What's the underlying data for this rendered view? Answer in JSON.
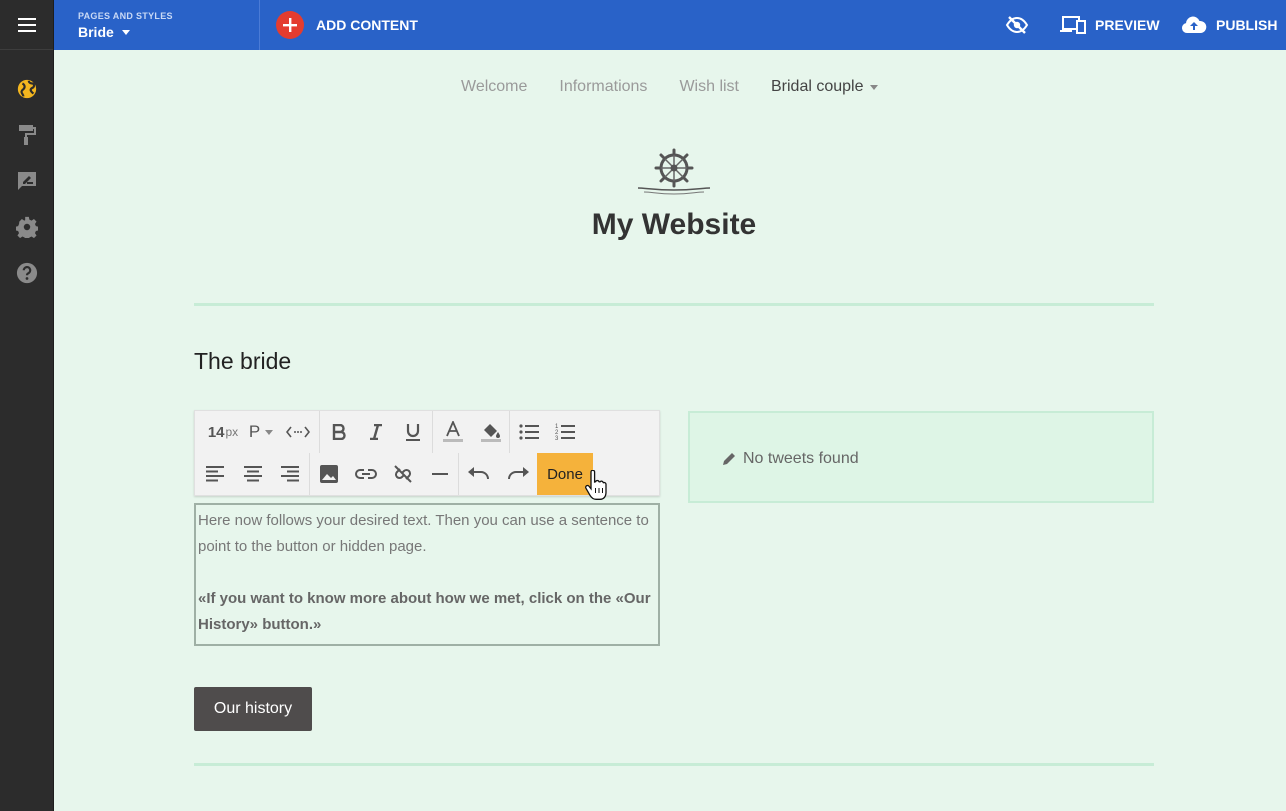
{
  "topbar": {
    "pages_label": "PAGES AND STYLES",
    "current_page": "Bride",
    "add_content": "ADD CONTENT",
    "preview": "PREVIEW",
    "publish": "PUBLISH"
  },
  "sidebar": {
    "icons": [
      "menu-icon",
      "globe-icon",
      "paint-roller-icon",
      "feedback-icon",
      "gear-icon",
      "help-icon"
    ]
  },
  "nav": {
    "items": [
      "Welcome",
      "Informations",
      "Wish list",
      "Bridal couple"
    ]
  },
  "site": {
    "title": "My Website"
  },
  "section": {
    "title": "The bride"
  },
  "toolbar": {
    "font_size": "14",
    "font_unit": "px",
    "paragraph": "P",
    "done": "Done"
  },
  "content": {
    "paragraph": "Here now follows your desired text. Then you can use a sentence to point to the button or hidden page.",
    "quote": "«If you want to know more about how we met, click on the «Our History» button.»"
  },
  "tweets": {
    "message": "No tweets found"
  },
  "button": {
    "history": "Our history"
  },
  "colors": {
    "topbar": "#2962c8",
    "sidebar": "#2c2c2c",
    "canvas": "#e7f6ec",
    "accent_red": "#e43c2f",
    "done": "#f5b23b",
    "sidebar_active": "#f3b61f"
  }
}
